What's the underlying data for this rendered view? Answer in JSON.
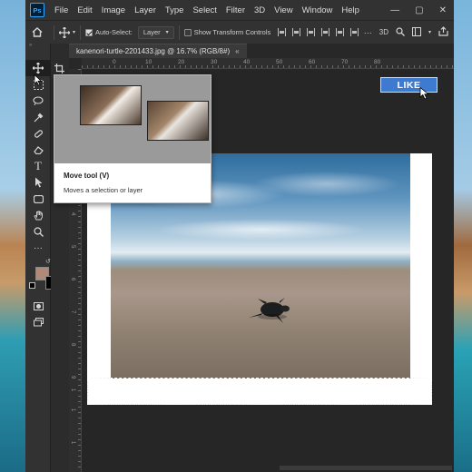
{
  "menubar": {
    "app_logo": "Ps",
    "items": [
      "File",
      "Edit",
      "Image",
      "Layer",
      "Type",
      "Select",
      "Filter",
      "3D",
      "View",
      "Window",
      "Help"
    ]
  },
  "options_bar": {
    "auto_select_label": "Auto-Select:",
    "auto_select_checked": true,
    "layer_dropdown": "Layer",
    "show_transform_label": "Show Transform Controls",
    "show_transform_checked": false
  },
  "document": {
    "tab_title": "kanenori-turtle-2201433.jpg @ 16.7% (RGB/8#)",
    "tab_close": "«"
  },
  "rulers": {
    "top": [
      "0",
      "10",
      "20",
      "30",
      "40",
      "50",
      "60",
      "70",
      "80"
    ],
    "left": [
      "0",
      "1",
      "2",
      "3",
      "4",
      "5",
      "6",
      "7",
      "8",
      "9",
      "1",
      "1",
      "1"
    ]
  },
  "tooltip": {
    "title": "Move tool (V)",
    "description": "Moves a selection or layer"
  },
  "overlay": {
    "like_label": "LIKE"
  },
  "colors": {
    "accent": "#31a8ff",
    "foreground_swatch": "#b08a78",
    "background_swatch": "#000000",
    "like_bg": "#3e7bd0"
  },
  "tools": [
    "move-tool",
    "marquee-tool",
    "lasso-tool",
    "eyedropper-tool",
    "spot-healing-tool",
    "eraser-tool",
    "type-tool",
    "path-selection-tool",
    "shape-tool",
    "hand-tool",
    "zoom-tool",
    "more-tools"
  ]
}
